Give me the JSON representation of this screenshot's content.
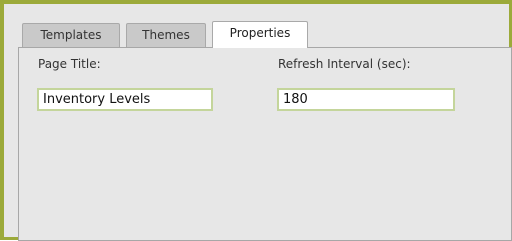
{
  "tabs": [
    {
      "label": "Templates"
    },
    {
      "label": "Themes"
    },
    {
      "label": "Properties",
      "active": true
    }
  ],
  "properties": {
    "page_title": {
      "label": "Page Title:",
      "value": "Inventory Levels"
    },
    "refresh_interval": {
      "label": "Refresh Interval (sec):",
      "value": "180"
    }
  },
  "colors": {
    "accent_border": "#9caa3a",
    "input_border": "#c4d59b",
    "panel_background": "#e7e7e7",
    "inactive_tab": "#c9c9c9",
    "active_tab": "#ffffff"
  }
}
